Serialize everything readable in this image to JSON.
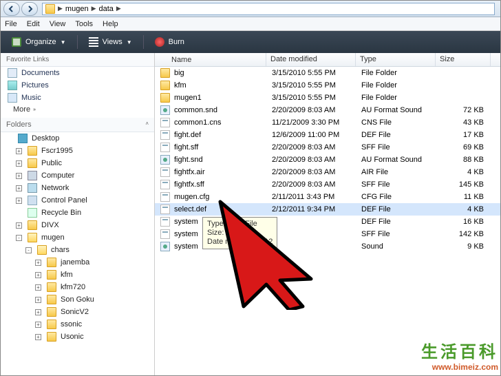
{
  "breadcrumb": {
    "parts": [
      "mugen",
      "data"
    ]
  },
  "menu": {
    "file": "File",
    "edit": "Edit",
    "view": "View",
    "tools": "Tools",
    "help": "Help"
  },
  "toolbar": {
    "organize": "Organize",
    "views": "Views",
    "burn": "Burn"
  },
  "favorites": {
    "header": "Favorite Links",
    "items": [
      {
        "icon": "doc",
        "label": "Documents"
      },
      {
        "icon": "pic",
        "label": "Pictures"
      },
      {
        "icon": "music",
        "label": "Music"
      }
    ],
    "more": "More"
  },
  "folders": {
    "header": "Folders",
    "tree": [
      {
        "indent": 0,
        "tw": "",
        "icon": "desktop",
        "label": "Desktop"
      },
      {
        "indent": 1,
        "tw": "+",
        "icon": "folder",
        "label": "Fscr1995"
      },
      {
        "indent": 1,
        "tw": "+",
        "icon": "folder",
        "label": "Public"
      },
      {
        "indent": 1,
        "tw": "+",
        "icon": "computer",
        "label": "Computer"
      },
      {
        "indent": 1,
        "tw": "+",
        "icon": "network",
        "label": "Network"
      },
      {
        "indent": 1,
        "tw": "+",
        "icon": "panel",
        "label": "Control Panel"
      },
      {
        "indent": 1,
        "tw": "",
        "icon": "recycle",
        "label": "Recycle Bin"
      },
      {
        "indent": 1,
        "tw": "+",
        "icon": "folder",
        "label": "DIVX"
      },
      {
        "indent": 1,
        "tw": "-",
        "icon": "folder-open",
        "label": "mugen"
      },
      {
        "indent": 2,
        "tw": "-",
        "icon": "folder-open",
        "label": "chars"
      },
      {
        "indent": 3,
        "tw": "+",
        "icon": "folder",
        "label": "janemba"
      },
      {
        "indent": 3,
        "tw": "+",
        "icon": "folder",
        "label": "kfm"
      },
      {
        "indent": 3,
        "tw": "+",
        "icon": "folder",
        "label": "kfm720"
      },
      {
        "indent": 3,
        "tw": "+",
        "icon": "folder",
        "label": "Son Goku"
      },
      {
        "indent": 3,
        "tw": "+",
        "icon": "folder",
        "label": "SonicV2"
      },
      {
        "indent": 3,
        "tw": "+",
        "icon": "folder",
        "label": "ssonic"
      },
      {
        "indent": 3,
        "tw": "+",
        "icon": "folder",
        "label": "Usonic"
      }
    ]
  },
  "filelist": {
    "headers": {
      "name": "Name",
      "date": "Date modified",
      "type": "Type",
      "size": "Size"
    },
    "rows": [
      {
        "icon": "folder",
        "name": "big",
        "date": "3/15/2010 5:55 PM",
        "type": "File Folder",
        "size": ""
      },
      {
        "icon": "folder",
        "name": "kfm",
        "date": "3/15/2010 5:55 PM",
        "type": "File Folder",
        "size": ""
      },
      {
        "icon": "folder",
        "name": "mugen1",
        "date": "3/15/2010 5:55 PM",
        "type": "File Folder",
        "size": ""
      },
      {
        "icon": "au",
        "name": "common.snd",
        "date": "2/20/2009 8:03 AM",
        "type": "AU Format Sound",
        "size": "72 KB"
      },
      {
        "icon": "unknown",
        "name": "common1.cns",
        "date": "11/21/2009 3:30 PM",
        "type": "CNS File",
        "size": "43 KB"
      },
      {
        "icon": "unknown",
        "name": "fight.def",
        "date": "12/6/2009 11:00 PM",
        "type": "DEF File",
        "size": "17 KB"
      },
      {
        "icon": "unknown",
        "name": "fight.sff",
        "date": "2/20/2009 8:03 AM",
        "type": "SFF File",
        "size": "69 KB"
      },
      {
        "icon": "au",
        "name": "fight.snd",
        "date": "2/20/2009 8:03 AM",
        "type": "AU Format Sound",
        "size": "88 KB"
      },
      {
        "icon": "unknown",
        "name": "fightfx.air",
        "date": "2/20/2009 8:03 AM",
        "type": "AIR File",
        "size": "4 KB"
      },
      {
        "icon": "unknown",
        "name": "fightfx.sff",
        "date": "2/20/2009 8:03 AM",
        "type": "SFF File",
        "size": "145 KB"
      },
      {
        "icon": "unknown",
        "name": "mugen.cfg",
        "date": "2/11/2011 3:43 PM",
        "type": "CFG File",
        "size": "11 KB"
      },
      {
        "icon": "unknown",
        "name": "select.def",
        "date": "2/12/2011 9:34 PM",
        "type": "DEF File",
        "size": "4 KB",
        "sel": true
      },
      {
        "icon": "unknown",
        "name": "system",
        "date": "",
        "type": "DEF File",
        "size": "16 KB"
      },
      {
        "icon": "unknown",
        "name": "system",
        "date": "",
        "type": "SFF File",
        "size": "142 KB"
      },
      {
        "icon": "au",
        "name": "system",
        "date": "",
        "type": "Sound",
        "size": "9 KB"
      }
    ]
  },
  "tooltip": {
    "line1": "Type: DEF File",
    "line2": "Size: 3.74 KB",
    "line3": "Date modified: 2/12"
  },
  "watermark": {
    "cn": "生活百科",
    "url": "www.bimeiz.com"
  }
}
